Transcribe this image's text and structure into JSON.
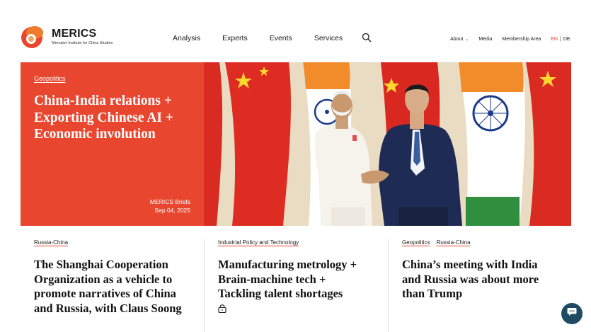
{
  "brand": {
    "name": "MERICS",
    "subtitle": "Mercator Institute for China Studies",
    "colors": {
      "accent": "#e8462f",
      "orange": "#f07b2a",
      "text": "#1a1a1a",
      "chat": "#1f4a64"
    }
  },
  "main_nav": [
    "Analysis",
    "Experts",
    "Events",
    "Services"
  ],
  "sub_nav": {
    "about": "About",
    "media": "Media",
    "membership": "Membership Area",
    "lang_en": "EN",
    "lang_sep": "|",
    "lang_de": "DE"
  },
  "hero": {
    "tag": "Geopolitics",
    "title": "China-India relations + Exporting Chinese AI + Economic involution",
    "series": "MERICS Briefs",
    "date": "Sep 04, 2025"
  },
  "articles": [
    {
      "tags": [
        "Russia-China"
      ],
      "title": "The Shanghai Cooperation Organization as a vehicle to promote narratives of China and Russia, with Claus Soong",
      "locked": false
    },
    {
      "tags": [
        "Industrial Policy and Technology"
      ],
      "title": "Manufacturing metrology + Brain-machine tech + Tackling talent shortages",
      "locked": true
    },
    {
      "tags": [
        "Geopolitics",
        "Russia-China"
      ],
      "title": "China’s meeting with India and Russia was about more than Trump",
      "locked": false
    }
  ],
  "icons": {
    "search": "search-icon",
    "lock": "lock-icon",
    "chat": "chat-icon",
    "chevron": "chevron-down-icon"
  }
}
